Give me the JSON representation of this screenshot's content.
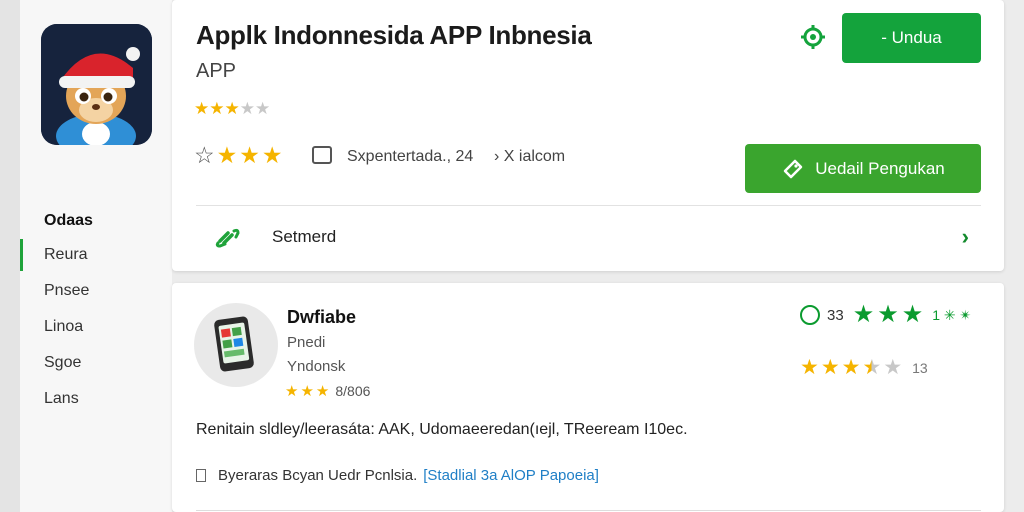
{
  "app": {
    "title": "Applk Indonnesida APP Inbnesia",
    "subtitle": "APP",
    "rating_stars": 3,
    "meta_stars": 3,
    "meta_text": "Sxpentertada., 24",
    "meta_downloads": "› X ialcom",
    "icon_name": "app-mascot-santa-hat"
  },
  "buttons": {
    "download_label": "- Undua",
    "detail_label": "Uedail Pengukan"
  },
  "security_row": {
    "label": "Setmerd",
    "icon": "link-icon"
  },
  "sidebar": {
    "title": "Odaas",
    "items": [
      {
        "label": "Reura",
        "active": true
      },
      {
        "label": "Pnsee",
        "active": false
      },
      {
        "label": "Linoa",
        "active": false
      },
      {
        "label": "Sgoe",
        "active": false
      },
      {
        "label": "Lans",
        "active": false
      }
    ]
  },
  "developer": {
    "name": "Dwfiabe",
    "line2": "Pnedi",
    "line3": "Yndonsk",
    "rating_text": "8/806",
    "rating_stars": 3,
    "right_rating1_num": "33",
    "right_rating1_tail": "1 ✳ ✴",
    "right_rating2_stars": 3.5,
    "right_rating2_num": "13",
    "description": "Renitain sldley/leerasáta: AAK, Udomaeeredan(ıejl, TReeream I10ec.",
    "footer_text": "Byeraras Bcyan Uedr Pcnlsia.",
    "footer_link": "[Stadlial 3a AlOP Papoeia]",
    "thumb_icon": "phone-icon"
  },
  "colors": {
    "brand_green": "#14a33c",
    "star_yellow": "#f5b400",
    "link_blue": "#1f7fc6"
  }
}
